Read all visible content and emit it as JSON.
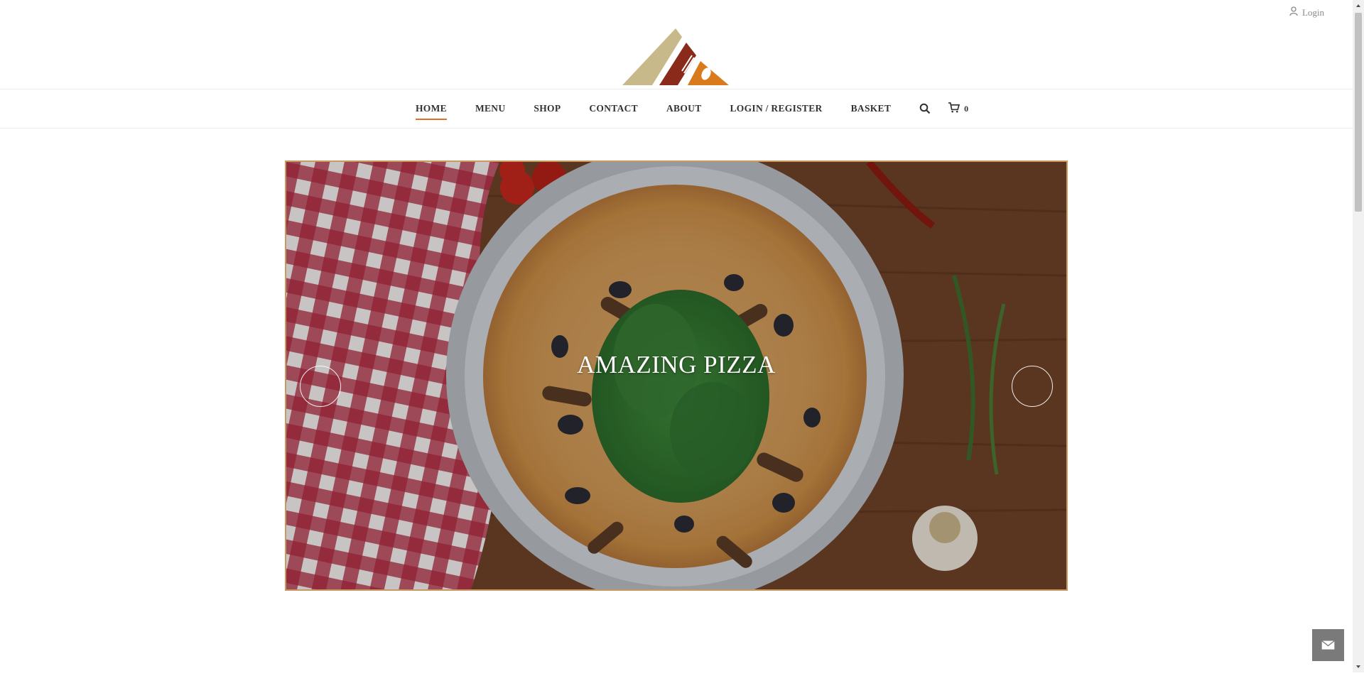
{
  "topbar": {
    "login_label": "Login",
    "user_icon": "user-icon"
  },
  "logo": {
    "icon": "restaurant-logo-icon",
    "colors": [
      "#c8b98a",
      "#8a2a1a",
      "#d97a1c"
    ]
  },
  "nav": {
    "items": [
      {
        "label": "HOME",
        "active": true
      },
      {
        "label": "MENU"
      },
      {
        "label": "SHOP"
      },
      {
        "label": "CONTACT"
      },
      {
        "label": "ABOUT"
      },
      {
        "label": "LOGIN / REGISTER"
      },
      {
        "label": "BASKET"
      }
    ],
    "search_icon": "search-icon",
    "cart": {
      "icon": "cart-icon",
      "count": "0"
    },
    "accent": "#e0702a"
  },
  "slider": {
    "title": "AMAZING PIZZA",
    "prev_icon": "prev-arrow-icon",
    "next_icon": "next-arrow-icon"
  },
  "contact": {
    "icon": "envelope-icon"
  }
}
